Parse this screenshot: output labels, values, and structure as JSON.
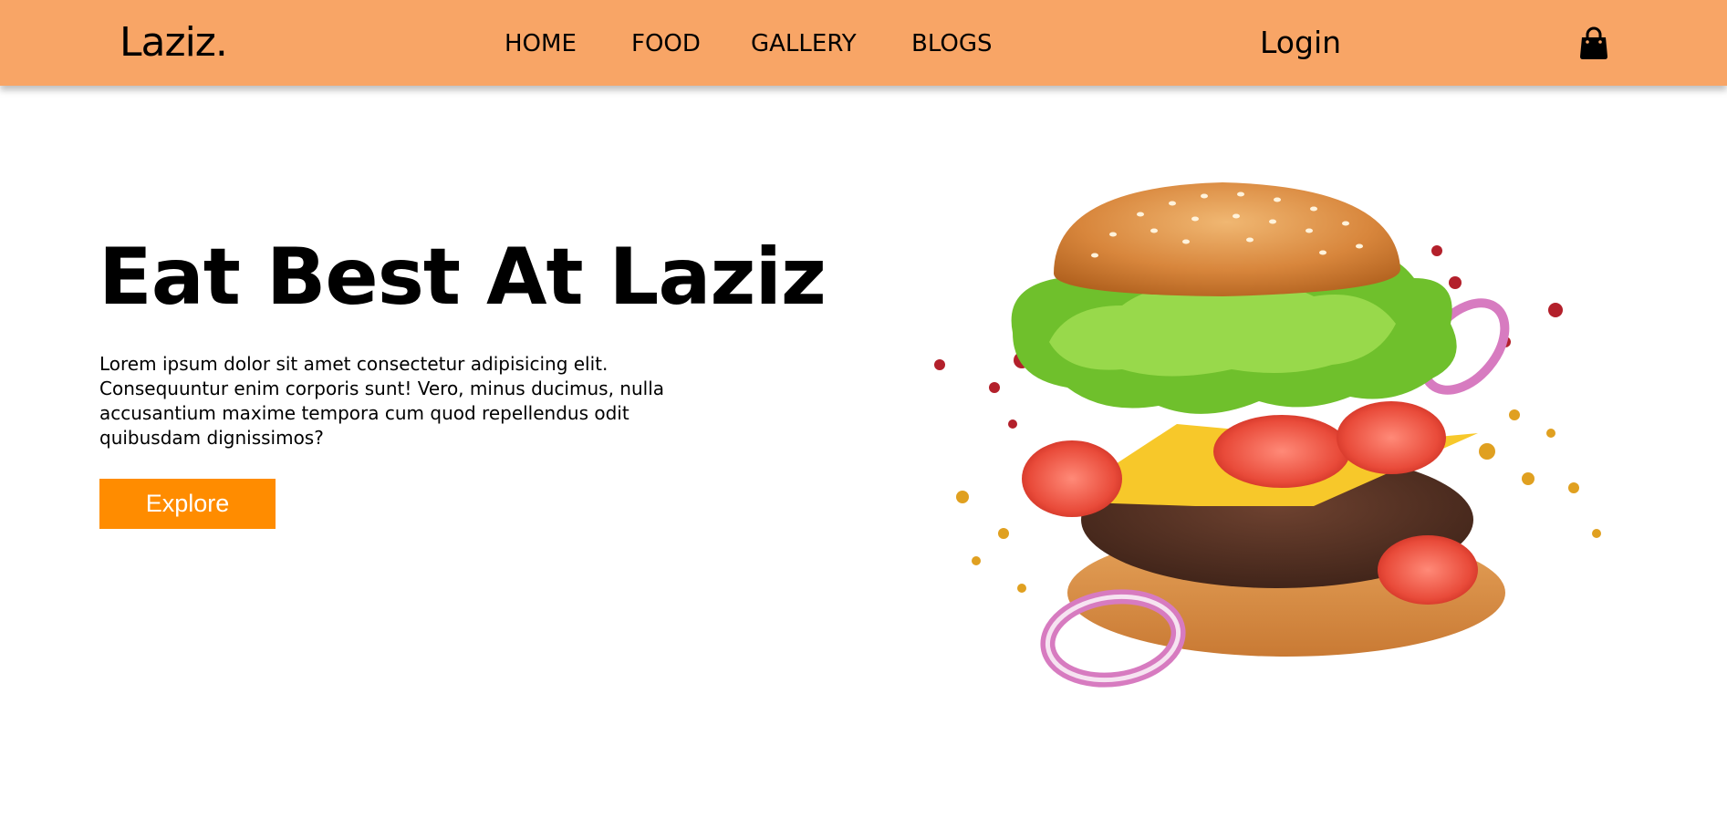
{
  "navbar": {
    "brand": "Laziz.",
    "links": [
      "HOME",
      "FOOD",
      "GALLERY",
      "BLOGS"
    ],
    "login": "Login",
    "cart_icon": "shopping-bag-icon",
    "background": "#f8a566"
  },
  "hero": {
    "title": "Eat Best At Laziz",
    "text": "Lorem ipsum dolor sit amet consectetur adipisicing elit. Consequuntur enim corporis sunt! Vero, minus ducimus, nulla accusantium maxime tempora cum quod repellendus odit quibusdam dignissimos?",
    "button": "Explore",
    "button_color": "#ff8c00",
    "image": "burger-image"
  }
}
